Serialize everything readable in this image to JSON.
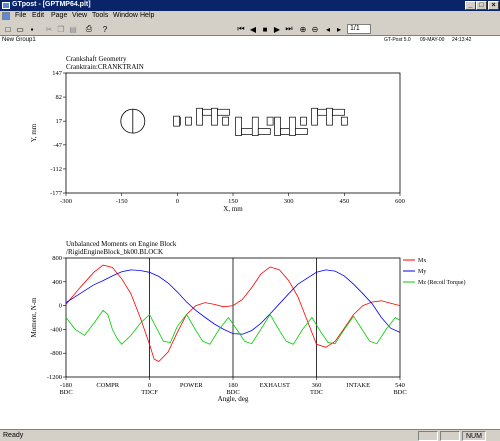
{
  "window": {
    "title": "GTpost - [GPTMP64.plt]",
    "minimize": "_",
    "maximize": "□",
    "close": "×"
  },
  "menu": [
    "File",
    "Edit",
    "Page",
    "View",
    "Tools",
    "Window",
    "Help"
  ],
  "toolbar": {
    "page": "1/1"
  },
  "doc_header": {
    "group": "New Group1",
    "version": "GT-Post 5.0",
    "date": "09-MAY-00",
    "time": "24:13:42"
  },
  "chart_data": [
    {
      "type": "scatter",
      "title": "Crankshaft Geometry",
      "subtitle": "Cranktrain:CRANKTRAIN",
      "xlabel": "X, mm",
      "ylabel": "Y, mm",
      "xlim": [
        -300,
        600
      ],
      "ylim": [
        -177,
        147
      ],
      "xticks": [
        "-300",
        "-150",
        "0",
        "150",
        "300",
        "450",
        "600"
      ],
      "yticks": [
        "147",
        "82",
        "17",
        "-47",
        "-112",
        "-177"
      ],
      "flywheel_center": [
        -120,
        17
      ],
      "crank_throws": [
        {
          "x": 60,
          "y": 41
        },
        {
          "x": 100,
          "y": 41
        },
        {
          "x": 165,
          "y": -11
        },
        {
          "x": 210,
          "y": -11
        },
        {
          "x": 270,
          "y": -11
        },
        {
          "x": 310,
          "y": -11
        },
        {
          "x": 370,
          "y": 41
        },
        {
          "x": 410,
          "y": 41
        }
      ]
    },
    {
      "type": "line",
      "title": "Unbalanced Moments on Engine Block",
      "subtitle": "/RigidEngineBlock_bk00.BLOCK",
      "xlabel": "Angle, deg",
      "ylabel": "Moment, N-m",
      "xlim": [
        -180,
        540
      ],
      "ylim": [
        -1200,
        800
      ],
      "xticks": [
        "-180",
        "0",
        "180",
        "360",
        "540"
      ],
      "xtick_sub": [
        "BDC",
        "TDCF",
        "BDC",
        "TDC",
        "BDC"
      ],
      "yticks": [
        "800",
        "400",
        "0",
        "-400",
        "-800",
        "-1200"
      ],
      "strokes": [
        "COMPR",
        "POWER",
        "EXHAUST",
        "INTAKE"
      ],
      "vlines": [
        0,
        180,
        360
      ],
      "colors": {
        "mx": "#ff0000",
        "my": "#0000ff",
        "mz": "#00cc00"
      },
      "series": [
        {
          "name": "Mx",
          "color": "#ff0000",
          "points": [
            [
              -180,
              20
            ],
            [
              -150,
              300
            ],
            [
              -120,
              560
            ],
            [
              -100,
              680
            ],
            [
              -80,
              640
            ],
            [
              -60,
              450
            ],
            [
              -40,
              200
            ],
            [
              -20,
              -200
            ],
            [
              0,
              -650
            ],
            [
              10,
              -900
            ],
            [
              20,
              -940
            ],
            [
              40,
              -780
            ],
            [
              60,
              -450
            ],
            [
              80,
              -150
            ],
            [
              100,
              0
            ],
            [
              120,
              50
            ],
            [
              140,
              20
            ],
            [
              160,
              -20
            ],
            [
              180,
              0
            ],
            [
              200,
              100
            ],
            [
              220,
              300
            ],
            [
              240,
              530
            ],
            [
              260,
              650
            ],
            [
              280,
              600
            ],
            [
              300,
              420
            ],
            [
              320,
              150
            ],
            [
              340,
              -250
            ],
            [
              360,
              -650
            ],
            [
              380,
              -700
            ],
            [
              400,
              -600
            ],
            [
              420,
              -380
            ],
            [
              440,
              -150
            ],
            [
              460,
              0
            ],
            [
              480,
              60
            ],
            [
              500,
              80
            ],
            [
              520,
              40
            ],
            [
              540,
              0
            ]
          ]
        },
        {
          "name": "My",
          "color": "#0000ff",
          "points": [
            [
              -180,
              50
            ],
            [
              -160,
              150
            ],
            [
              -140,
              250
            ],
            [
              -120,
              350
            ],
            [
              -100,
              420
            ],
            [
              -80,
              500
            ],
            [
              -60,
              570
            ],
            [
              -40,
              600
            ],
            [
              -20,
              590
            ],
            [
              0,
              560
            ],
            [
              20,
              490
            ],
            [
              40,
              380
            ],
            [
              60,
              230
            ],
            [
              80,
              60
            ],
            [
              100,
              -80
            ],
            [
              120,
              -200
            ],
            [
              140,
              -310
            ],
            [
              160,
              -400
            ],
            [
              180,
              -470
            ],
            [
              200,
              -480
            ],
            [
              220,
              -420
            ],
            [
              240,
              -300
            ],
            [
              260,
              -140
            ],
            [
              280,
              30
            ],
            [
              300,
              200
            ],
            [
              320,
              360
            ],
            [
              340,
              460
            ],
            [
              360,
              560
            ],
            [
              380,
              600
            ],
            [
              400,
              580
            ],
            [
              420,
              500
            ],
            [
              440,
              360
            ],
            [
              460,
              200
            ],
            [
              480,
              30
            ],
            [
              500,
              -200
            ],
            [
              520,
              -380
            ],
            [
              540,
              -450
            ]
          ]
        },
        {
          "name": "Mz (Recoil Torque)",
          "color": "#00cc00",
          "points": [
            [
              -180,
              -200
            ],
            [
              -160,
              -400
            ],
            [
              -140,
              -500
            ],
            [
              -120,
              -300
            ],
            [
              -100,
              -80
            ],
            [
              -90,
              -150
            ],
            [
              -80,
              -400
            ],
            [
              -70,
              -550
            ],
            [
              -60,
              -650
            ],
            [
              -40,
              -500
            ],
            [
              -20,
              -300
            ],
            [
              0,
              -150
            ],
            [
              20,
              -450
            ],
            [
              30,
              -600
            ],
            [
              45,
              -620
            ],
            [
              60,
              -350
            ],
            [
              80,
              -150
            ],
            [
              100,
              -420
            ],
            [
              115,
              -600
            ],
            [
              130,
              -650
            ],
            [
              150,
              -400
            ],
            [
              170,
              -200
            ],
            [
              190,
              -420
            ],
            [
              205,
              -600
            ],
            [
              220,
              -640
            ],
            [
              240,
              -400
            ],
            [
              260,
              -150
            ],
            [
              280,
              -420
            ],
            [
              295,
              -600
            ],
            [
              310,
              -650
            ],
            [
              330,
              -400
            ],
            [
              350,
              -200
            ],
            [
              370,
              -450
            ],
            [
              385,
              -620
            ],
            [
              400,
              -640
            ],
            [
              420,
              -400
            ],
            [
              440,
              -180
            ],
            [
              460,
              -420
            ],
            [
              475,
              -600
            ],
            [
              490,
              -640
            ],
            [
              510,
              -400
            ],
            [
              530,
              -200
            ],
            [
              540,
              -250
            ]
          ]
        }
      ]
    }
  ],
  "status": {
    "ready": "Ready",
    "num": "NUM"
  }
}
